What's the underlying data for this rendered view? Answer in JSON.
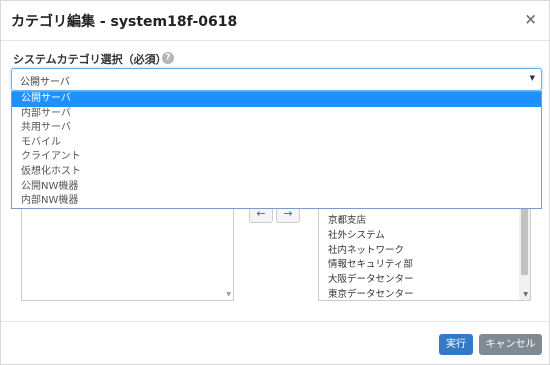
{
  "modal": {
    "title": "カテゴリ編集 - system18f-0618",
    "close_label": "×"
  },
  "field": {
    "label": "システムカテゴリ選択（必須）",
    "help_icon": "question-circle-icon",
    "help_glyph": "?",
    "selected_value": "公開サーバ",
    "caret": "▼"
  },
  "dropdown": {
    "options": [
      "公開サーバ",
      "内部サーバ",
      "共用サーバ",
      "モバイル",
      "クライアント",
      "仮想化ホスト",
      "公開NW機器",
      "内部NW機器"
    ],
    "selected_index": 0
  },
  "move_buttons": {
    "left": "←",
    "right": "→"
  },
  "right_list": {
    "items": [
      "京都支店",
      "社外システム",
      "社内ネットワーク",
      "情報セキュリティ部",
      "大阪データセンター",
      "東京データセンター"
    ]
  },
  "footer": {
    "execute_label": "実行",
    "cancel_label": "キャンセル"
  },
  "colors": {
    "primary": "#3379c4",
    "secondary": "#7f8a93",
    "selected_option": "#1e90ff"
  }
}
